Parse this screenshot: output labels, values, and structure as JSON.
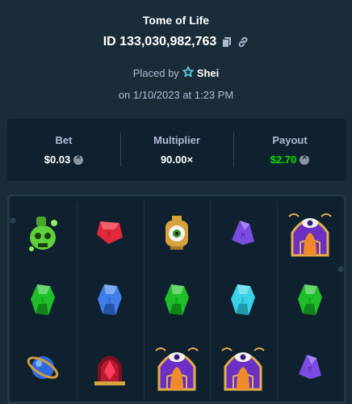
{
  "header": {
    "title": "Tome of Life",
    "bet_id": "ID 133,030,982,763",
    "placed_by_prefix": "Placed by",
    "username": "Shei",
    "date": "on 1/10/2023 at 1:23 PM"
  },
  "stats": {
    "bet_label": "Bet",
    "bet_value": "$0.03",
    "multiplier_label": "Multiplier",
    "multiplier_value": "90.00×",
    "payout_label": "Payout",
    "payout_value": "$2.70"
  },
  "colors": {
    "background": "#1a2c38",
    "panel": "#0f212e",
    "muted_text": "#b1bad3",
    "payout_green": "#00e701"
  },
  "icons": {
    "copy": "copy-icon",
    "link": "link-icon",
    "vip": "vip-star-icon",
    "currency": "currency-coin-icon"
  },
  "board": {
    "reels": [
      [
        "green-potion-skull",
        "green-gem",
        "blue-orb-ring"
      ],
      [
        "red-gem",
        "blue-gem",
        "red-crystal-altar"
      ],
      [
        "eye-lantern",
        "green-gem",
        "purple-eye-shrine"
      ],
      [
        "purple-gem",
        "cyan-gem",
        "purple-eye-shrine"
      ],
      [
        "purple-eye-shrine",
        "green-gem",
        "purple-gem"
      ]
    ]
  }
}
